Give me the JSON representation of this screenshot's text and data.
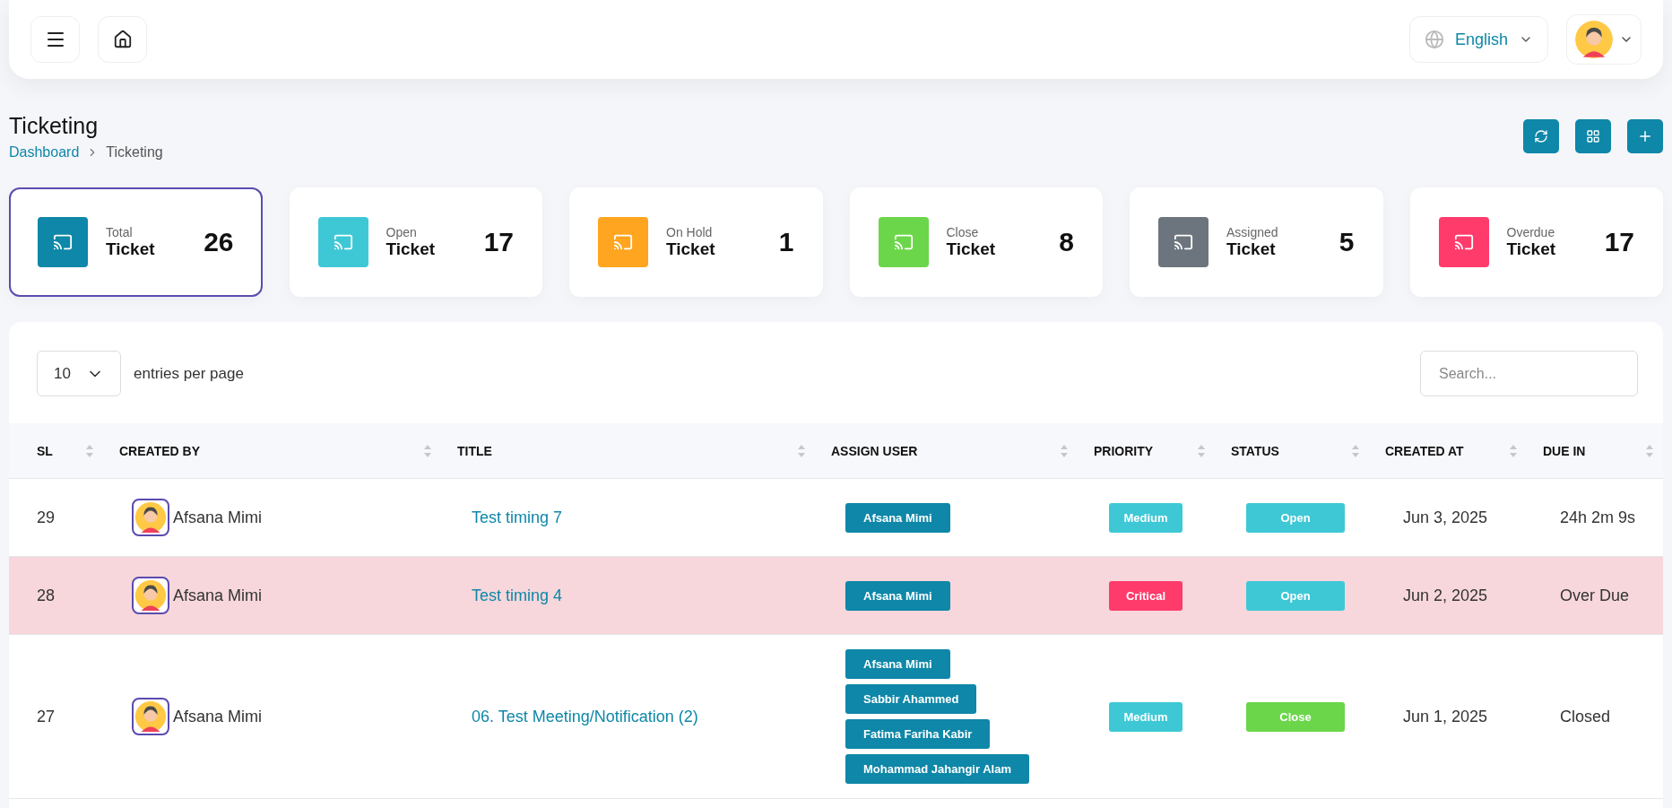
{
  "header": {
    "language": "English"
  },
  "page": {
    "title": "Ticketing",
    "breadcrumb": [
      {
        "label": "Dashboard",
        "kind": "link"
      },
      {
        "label": "Ticketing",
        "kind": "current"
      }
    ]
  },
  "stats": [
    {
      "caption": "Total",
      "label": "Ticket",
      "value": "26",
      "color": "#0e87a8",
      "selected": true
    },
    {
      "caption": "Open",
      "label": "Ticket",
      "value": "17",
      "color": "#3ec8d6",
      "selected": false
    },
    {
      "caption": "On Hold",
      "label": "Ticket",
      "value": "1",
      "color": "#ffa51f",
      "selected": false
    },
    {
      "caption": "Close",
      "label": "Ticket",
      "value": "8",
      "color": "#6bd64a",
      "selected": false
    },
    {
      "caption": "Assigned",
      "label": "Ticket",
      "value": "5",
      "color": "#6c757d",
      "selected": false
    },
    {
      "caption": "Overdue",
      "label": "Ticket",
      "value": "17",
      "color": "#ff3b6b",
      "selected": false
    }
  ],
  "table": {
    "page_size": "10",
    "page_size_label": "entries per page",
    "search": {
      "placeholder": "Search..."
    },
    "columns": [
      "SL",
      "CREATED BY",
      "TITLE",
      "ASSIGN USER",
      "PRIORITY",
      "STATUS",
      "CREATED AT",
      "DUE IN"
    ],
    "rows": [
      {
        "sl": "29",
        "created_by": "Afsana Mimi",
        "title": "Test timing 7",
        "assignees": [
          "Afsana Mimi"
        ],
        "priority": {
          "label": "Medium",
          "color": "#3ec8d6"
        },
        "status": {
          "label": "Open",
          "color": "#3ec8d6"
        },
        "created_at": "Jun 3, 2025",
        "due_in": "24h 2m 9s",
        "highlighted": false
      },
      {
        "sl": "28",
        "created_by": "Afsana Mimi",
        "title": "Test timing 4",
        "assignees": [
          "Afsana Mimi"
        ],
        "priority": {
          "label": "Critical",
          "color": "#ff3b6b"
        },
        "status": {
          "label": "Open",
          "color": "#3ec8d6"
        },
        "created_at": "Jun 2, 2025",
        "due_in": "Over Due",
        "highlighted": true
      },
      {
        "sl": "27",
        "created_by": "Afsana Mimi",
        "title": "06. Test Meeting/Notification (2)",
        "assignees": [
          "Afsana Mimi",
          "Sabbir Ahammed",
          "Fatima Fariha Kabir",
          "Mohammad Jahangir Alam"
        ],
        "priority": {
          "label": "Medium",
          "color": "#3ec8d6"
        },
        "status": {
          "label": "Close",
          "color": "#6bd64a"
        },
        "created_at": "Jun 1, 2025",
        "due_in": "Closed",
        "highlighted": false
      }
    ]
  }
}
